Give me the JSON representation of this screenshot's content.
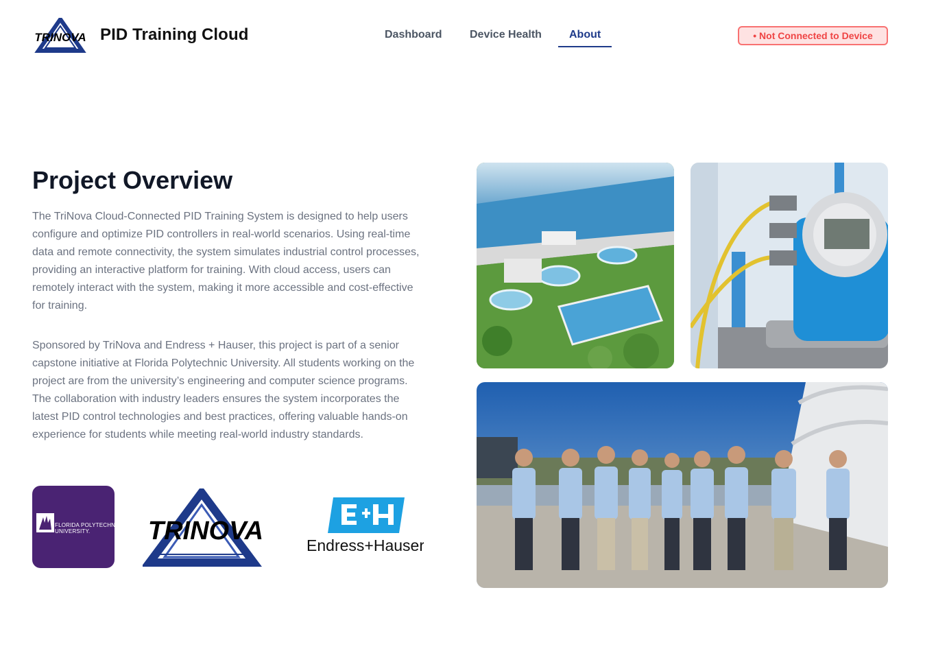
{
  "header": {
    "app_title": "PID Training Cloud",
    "logo_text": "TRINOVA",
    "nav": [
      {
        "label": "Dashboard",
        "active": false
      },
      {
        "label": "Device Health",
        "active": false
      },
      {
        "label": "About",
        "active": true
      }
    ],
    "status": "• Not Connected to Device"
  },
  "main": {
    "heading": "Project Overview",
    "paragraphs": [
      "The TriNova Cloud-Connected PID Training System is designed to help users configure and optimize PID controllers in real-world scenarios. Using real-time data and remote connectivity, the system simulates industrial control processes, providing an interactive platform for training. With cloud access, users can remotely interact with the system, making it more accessible and cost-effective for training.",
      "Sponsored by TriNova and Endress + Hauser, this project is part of a senior capstone initiative at Florida Polytechnic University. All students working on the project are from the university’s engineering and computer science programs. The collaboration with industry leaders ensures the system incorporates the latest PID control technologies and best practices, offering valuable hands-on experience for students while meeting real-world industry standards."
    ]
  },
  "sponsors": {
    "fpu_line1": "FLORIDA POLYTECHNIC",
    "fpu_line2": "UNIVERSITY.",
    "trinova": "TRINOVA",
    "eh_name": "Endress+Hauser"
  },
  "colors": {
    "accent": "#1e3a8a",
    "status_border": "#f87171",
    "status_bg": "#fee2e2",
    "status_text": "#ef4444",
    "fpu_purple": "#4a2373",
    "eh_blue": "#1da1e2"
  },
  "icons": {
    "logo": "trinova-logo-icon",
    "fpu": "fpu-logo-icon",
    "eh": "endress-hauser-logo-icon"
  }
}
